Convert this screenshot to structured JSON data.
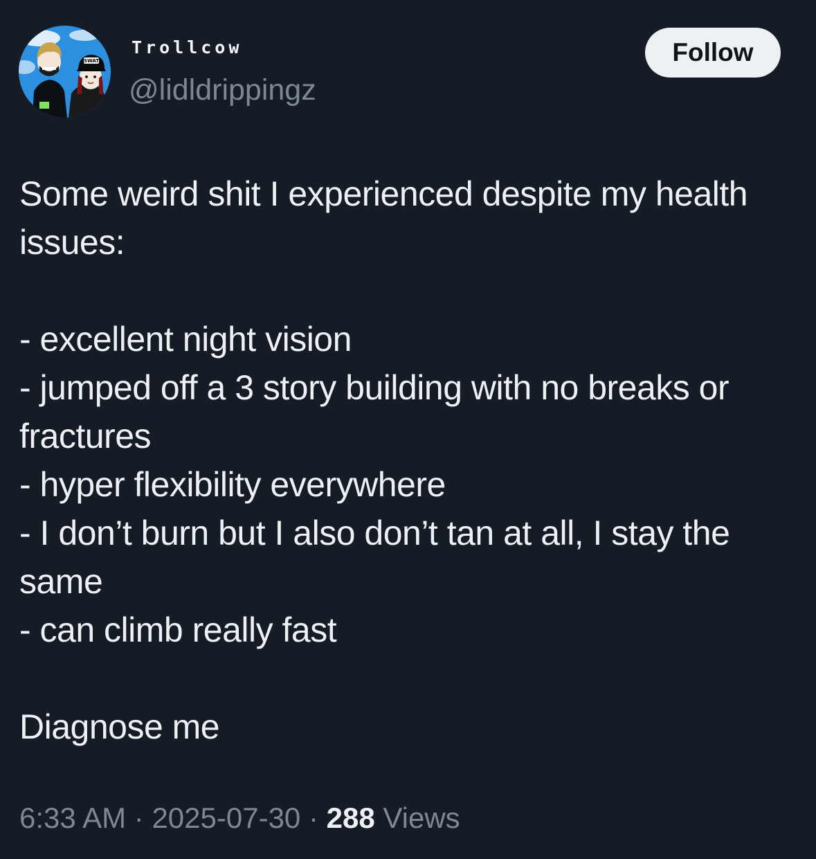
{
  "author": {
    "display_name": "Trollcow",
    "handle": "@lidldrippingz",
    "avatar_badge": "SWAT"
  },
  "follow_button": {
    "label": "Follow"
  },
  "tweet": {
    "intro_line": "Some weird shit I experienced despite my health issues:",
    "list_items": [
      "- excellent night vision",
      "- jumped off a 3 story building with no breaks or fractures",
      "- hyper flexibility everywhere",
      "- I don’t burn but I also don’t tan at all, I stay the same",
      "- can climb really fast"
    ],
    "closing_line": "Diagnose me"
  },
  "meta": {
    "time": "6:33 AM",
    "separator": "·",
    "date": "2025-07-30",
    "views_count": "288",
    "views_label": "Views"
  },
  "colors": {
    "background": "#161c26",
    "text_primary": "#eef1f4",
    "text_secondary": "#7d8896",
    "button_bg": "#eef1f4"
  }
}
